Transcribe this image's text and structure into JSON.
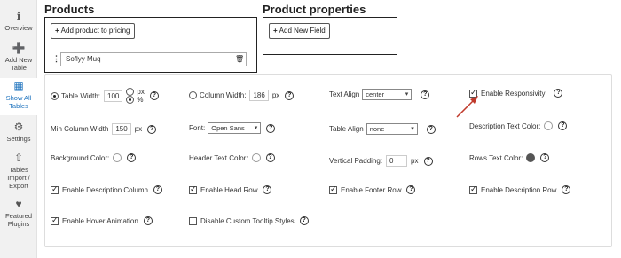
{
  "sidebar": {
    "items": [
      {
        "label": "Overview",
        "icon": "info-icon"
      },
      {
        "label": "Add New Table",
        "icon": "plus-circle-icon"
      },
      {
        "label": "Show All Tables",
        "icon": "table-icon",
        "active": true
      },
      {
        "label": "Settings",
        "icon": "gear-icon"
      },
      {
        "label": "Tables Import / Export",
        "icon": "upload-icon"
      },
      {
        "label": "Featured Plugins",
        "icon": "heart-icon"
      }
    ]
  },
  "products": {
    "title": "Products",
    "add_button": "Add product to pricing",
    "item_name": "Soflyy Muq"
  },
  "properties": {
    "title": "Product properties",
    "add_button": "Add New Field"
  },
  "settings": {
    "table_width_label": "Table Width:",
    "table_width_value": "100",
    "unit_px": "px",
    "unit_pct": "%",
    "column_width_label": "Column Width:",
    "column_width_value": "186",
    "column_width_unit": "px",
    "text_align_label": "Text Align",
    "text_align_value": "center",
    "enable_responsivity": "Enable Responsivity",
    "min_col_width_label": "Min Column Width",
    "min_col_width_value": "150",
    "min_col_width_unit": "px",
    "font_label": "Font:",
    "font_value": "Open Sans",
    "table_align_label": "Table Align",
    "table_align_value": "none",
    "desc_text_color": "Description Text Color:",
    "bg_color": "Background Color:",
    "header_text_color": "Header Text Color:",
    "vertical_padding_label": "Vertical Padding:",
    "vertical_padding_value": "0",
    "vertical_padding_unit": "px",
    "rows_text_color": "Rows Text Color:",
    "enable_desc_column": "Enable Description Column",
    "enable_head_row": "Enable Head Row",
    "enable_footer_row": "Enable Footer Row",
    "enable_desc_row": "Enable Description Row",
    "enable_hover": "Enable Hover Animation",
    "disable_tooltip": "Disable Custom Tooltip Styles"
  },
  "colors": {
    "accent": "#1e73be",
    "arrow": "#c0392b"
  }
}
